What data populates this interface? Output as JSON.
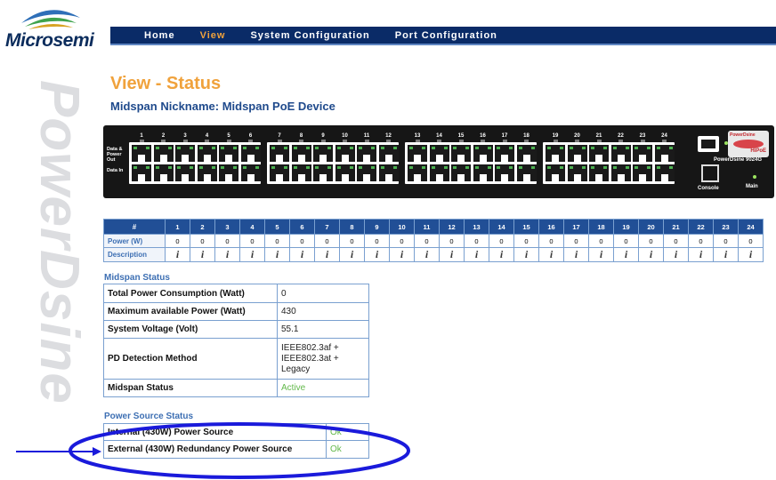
{
  "logo": {
    "text": "Microsemi"
  },
  "watermark": {
    "text": "PowerDsine"
  },
  "nav": [
    {
      "label": "Home",
      "active": false
    },
    {
      "label": "View",
      "active": true
    },
    {
      "label": "System Configuration",
      "active": false
    },
    {
      "label": "Port Configuration",
      "active": false
    }
  ],
  "page": {
    "title": "View - Status",
    "nickname": "Midspan Nickname: Midspan PoE Device"
  },
  "device": {
    "label_left": "Data &\nPower\nOut\n\nData In",
    "model": "PowerDsine 9024G",
    "console_label": "Console",
    "main_label": "Main",
    "badge_top": "PowerDsine",
    "badge_bottom": "HiPoE",
    "port_numbers": [
      "1",
      "2",
      "3",
      "4",
      "5",
      "6",
      "7",
      "8",
      "9",
      "10",
      "11",
      "12",
      "13",
      "14",
      "15",
      "16",
      "17",
      "18",
      "19",
      "20",
      "21",
      "22",
      "23",
      "24"
    ]
  },
  "port_table": {
    "header_label": "#",
    "power_label": "Power (W)",
    "desc_label": "Description",
    "ports": [
      "1",
      "2",
      "3",
      "4",
      "5",
      "6",
      "7",
      "8",
      "9",
      "10",
      "11",
      "12",
      "13",
      "14",
      "15",
      "16",
      "17",
      "18",
      "19",
      "20",
      "21",
      "22",
      "23",
      "24"
    ],
    "power": [
      "0",
      "0",
      "0",
      "0",
      "0",
      "0",
      "0",
      "0",
      "0",
      "0",
      "0",
      "0",
      "0",
      "0",
      "0",
      "0",
      "0",
      "0",
      "0",
      "0",
      "0",
      "0",
      "0",
      "0"
    ],
    "info_glyph": "i"
  },
  "midspan_status": {
    "title": "Midspan Status",
    "rows": [
      {
        "label": "Total Power Consumption (Watt)",
        "value": "0"
      },
      {
        "label": "Maximum available Power (Watt)",
        "value": "430"
      },
      {
        "label": "System Voltage (Volt)",
        "value": "55.1"
      },
      {
        "label": "PD Detection Method",
        "value": "IEEE802.3af +\nIEEE802.3at +\nLegacy"
      },
      {
        "label": "Midspan Status",
        "value": "Active",
        "ok": true
      }
    ]
  },
  "power_source_status": {
    "title": "Power Source Status",
    "rows": [
      {
        "label": "Internal (430W) Power Source",
        "value": "Ok"
      },
      {
        "label": "External (430W) Redundancy Power Source",
        "value": "Ok"
      }
    ]
  },
  "colors": {
    "nav_bg": "#0a2b67",
    "accent_orange": "#f0a23c",
    "link_blue": "#3d6fb3",
    "ok_green": "#62b84a",
    "annotation_blue": "#1a1adb"
  }
}
